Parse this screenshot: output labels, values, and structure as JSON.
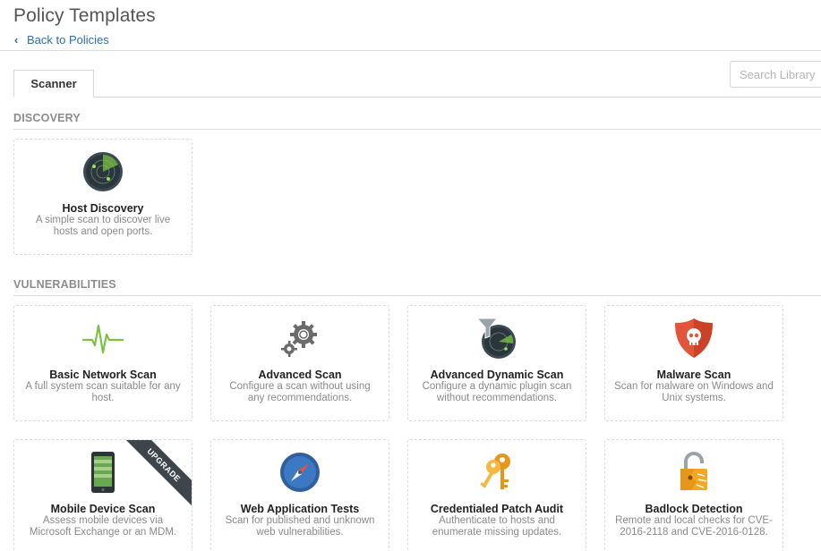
{
  "header": {
    "title": "Policy Templates",
    "back_label": "Back to Policies"
  },
  "search": {
    "placeholder": "Search Library"
  },
  "tabs": [
    {
      "label": "Scanner"
    }
  ],
  "sections": {
    "discovery": {
      "title": "DISCOVERY",
      "cards": [
        {
          "name": "Host Discovery",
          "description": "A simple scan to discover live hosts and open ports.",
          "icon": "radar-icon"
        }
      ]
    },
    "vulnerabilities": {
      "title": "VULNERABILITIES",
      "cards": [
        {
          "name": "Basic Network Scan",
          "description": "A full system scan suitable for any host.",
          "icon": "heartbeat-icon"
        },
        {
          "name": "Advanced Scan",
          "description": "Configure a scan without using any recommendations.",
          "icon": "gears-icon"
        },
        {
          "name": "Advanced Dynamic Scan",
          "description": "Configure a dynamic plugin scan without recommendations.",
          "icon": "filter-radar-icon"
        },
        {
          "name": "Malware Scan",
          "description": "Scan for malware on Windows and Unix systems.",
          "icon": "skull-shield-icon"
        },
        {
          "name": "Mobile Device Scan",
          "description": "Assess mobile devices via Microsoft Exchange or an MDM.",
          "icon": "mobile-phone-icon",
          "badge": "UPGRADE"
        },
        {
          "name": "Web Application Tests",
          "description": "Scan for published and unknown web vulnerabilities.",
          "icon": "compass-icon"
        },
        {
          "name": "Credentialed Patch Audit",
          "description": "Authenticate to hosts and enumerate missing updates.",
          "icon": "keys-icon"
        },
        {
          "name": "Badlock Detection",
          "description": "Remote and local checks for CVE-2016-2118 and CVE-2016-0128.",
          "icon": "broken-lock-icon"
        }
      ]
    }
  },
  "colors": {
    "link": "#2a6fad",
    "section_title": "#8c8c8c",
    "ribbon": "#3e464c",
    "radar_green": "#7bc143",
    "malware_red": "#e2553a",
    "key_orange": "#f5a623",
    "compass_blue": "#2f5f9e"
  }
}
